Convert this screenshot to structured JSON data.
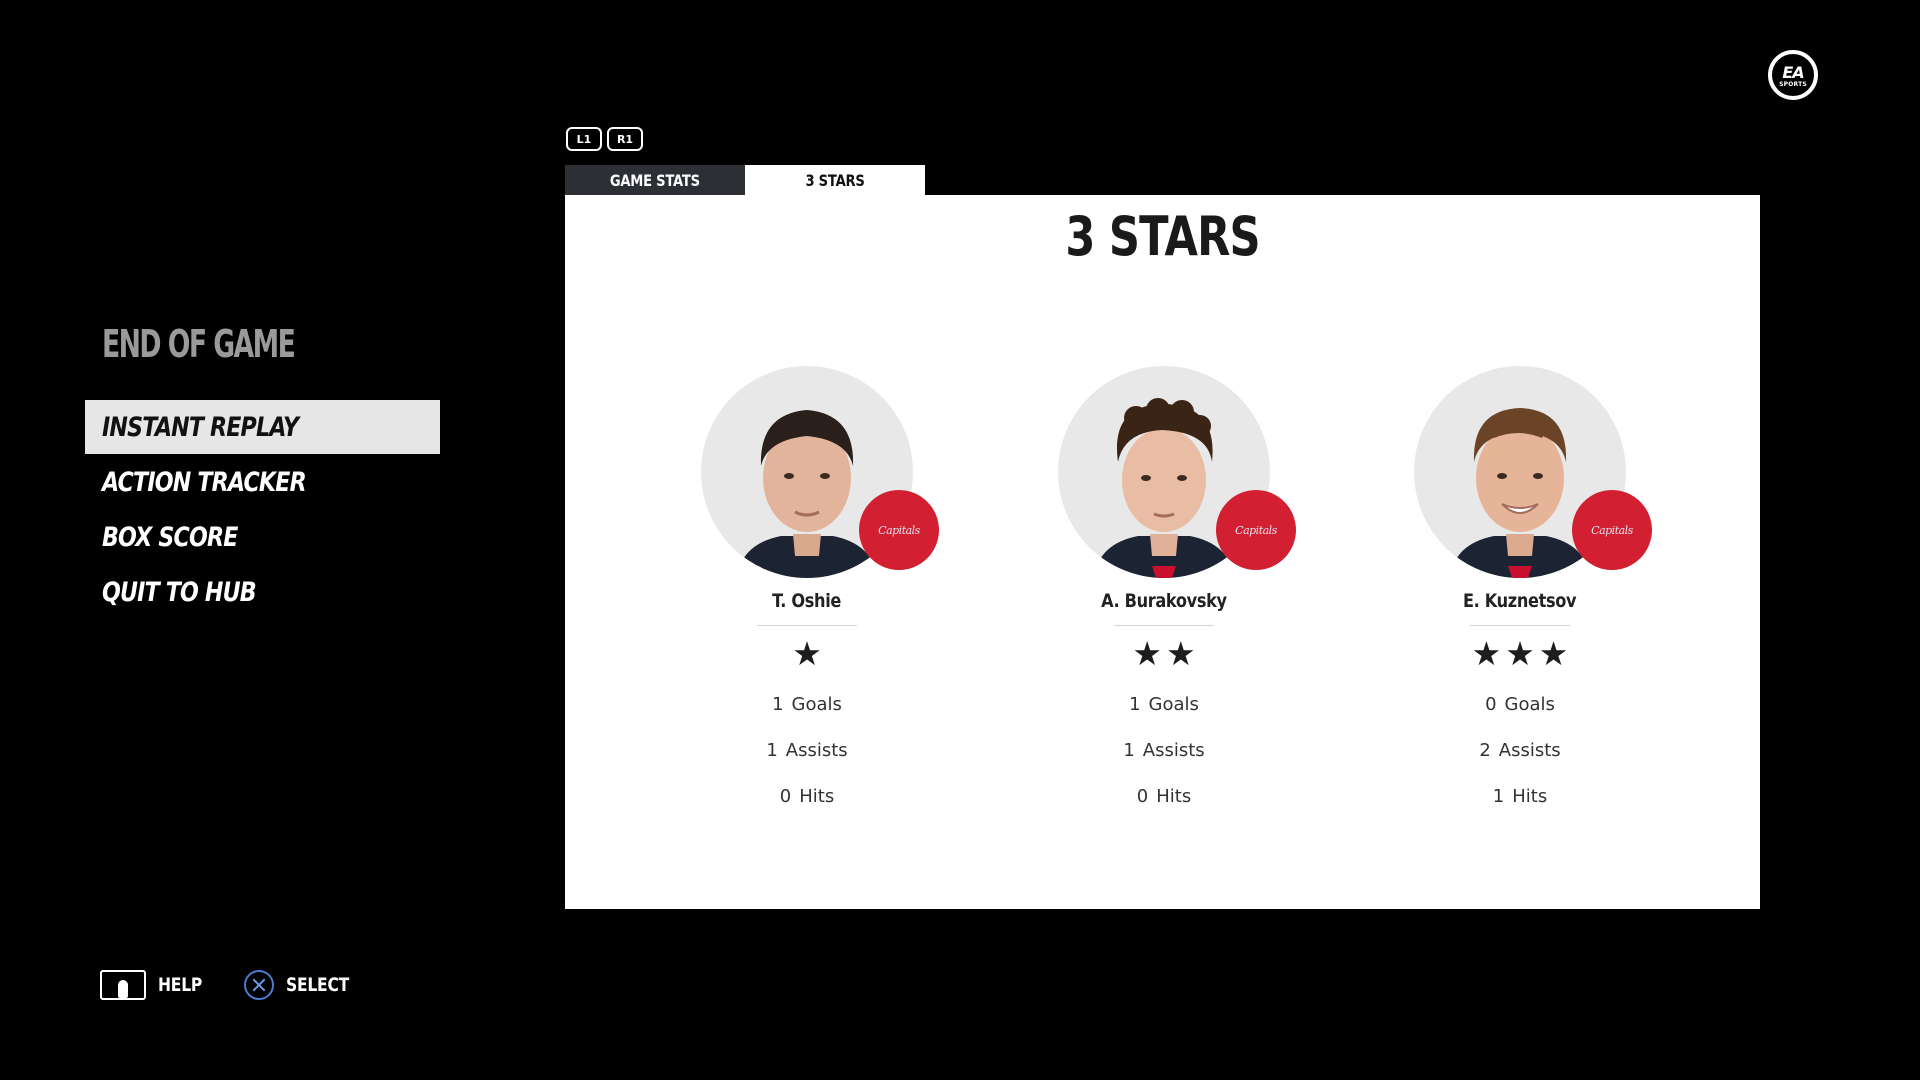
{
  "brand": {
    "logo_mark": "EA",
    "logo_sub": "SPORTS"
  },
  "menu": {
    "title": "END OF GAME",
    "items": [
      {
        "label": "INSTANT REPLAY",
        "selected": true
      },
      {
        "label": "ACTION TRACKER",
        "selected": false
      },
      {
        "label": "BOX SCORE",
        "selected": false
      },
      {
        "label": "QUIT TO HUB",
        "selected": false
      }
    ]
  },
  "controls": {
    "help_label": "HELP",
    "select_label": "SELECT",
    "help_icon": "touchpad-icon",
    "select_icon": "cross-button-icon"
  },
  "bumpers": {
    "left": "L1",
    "right": "R1"
  },
  "tabs": [
    {
      "label": "GAME STATS",
      "active": false
    },
    {
      "label": "3 STARS",
      "active": true
    }
  ],
  "panel": {
    "title": "3 STARS",
    "badge_text": "Capitals",
    "players": [
      {
        "name": "T. Oshie",
        "star_count": 1,
        "stats": [
          {
            "value": "1",
            "label": "Goals"
          },
          {
            "value": "1",
            "label": "Assists"
          },
          {
            "value": "0",
            "label": "Hits"
          }
        ]
      },
      {
        "name": "A. Burakovsky",
        "star_count": 2,
        "stats": [
          {
            "value": "1",
            "label": "Goals"
          },
          {
            "value": "1",
            "label": "Assists"
          },
          {
            "value": "0",
            "label": "Hits"
          }
        ]
      },
      {
        "name": "E. Kuznetsov",
        "star_count": 3,
        "stats": [
          {
            "value": "0",
            "label": "Goals"
          },
          {
            "value": "2",
            "label": "Assists"
          },
          {
            "value": "1",
            "label": "Hits"
          }
        ]
      }
    ]
  },
  "colors": {
    "background": "#000000",
    "panel": "#ffffff",
    "tab_inactive": "#2c2f34",
    "menu_selected": "#e6e6e6",
    "team_badge": "#d21f32",
    "cross_button": "#4a7bd0"
  }
}
